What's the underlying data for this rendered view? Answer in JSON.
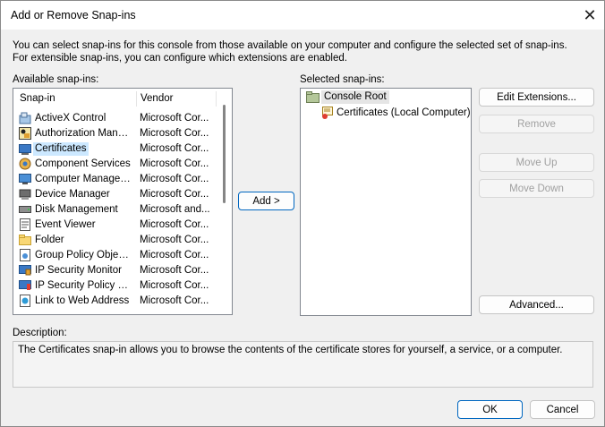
{
  "dialog": {
    "title": "Add or Remove Snap-ins",
    "intro": "You can select snap-ins for this console from those available on your computer and configure the selected set of snap-ins. For extensible snap-ins, you can configure which extensions are enabled."
  },
  "available": {
    "label": "Available snap-ins:",
    "col_snapin": "Snap-in",
    "col_vendor": "Vendor",
    "items": [
      {
        "name": "ActiveX Control",
        "vendor": "Microsoft Cor...",
        "icon": "activex-icon"
      },
      {
        "name": "Authorization Manager",
        "vendor": "Microsoft Cor...",
        "icon": "authorization-icon"
      },
      {
        "name": "Certificates",
        "vendor": "Microsoft Cor...",
        "icon": "certificates-icon"
      },
      {
        "name": "Component Services",
        "vendor": "Microsoft Cor...",
        "icon": "component-services-icon"
      },
      {
        "name": "Computer Managem...",
        "vendor": "Microsoft Cor...",
        "icon": "computer-management-icon"
      },
      {
        "name": "Device Manager",
        "vendor": "Microsoft Cor...",
        "icon": "device-manager-icon"
      },
      {
        "name": "Disk Management",
        "vendor": "Microsoft and...",
        "icon": "disk-management-icon"
      },
      {
        "name": "Event Viewer",
        "vendor": "Microsoft Cor...",
        "icon": "event-viewer-icon"
      },
      {
        "name": "Folder",
        "vendor": "Microsoft Cor...",
        "icon": "folder-icon"
      },
      {
        "name": "Group Policy Object ...",
        "vendor": "Microsoft Cor...",
        "icon": "group-policy-icon"
      },
      {
        "name": "IP Security Monitor",
        "vendor": "Microsoft Cor...",
        "icon": "ip-security-monitor-icon"
      },
      {
        "name": "IP Security Policy M...",
        "vendor": "Microsoft Cor...",
        "icon": "ip-security-policy-icon"
      },
      {
        "name": "Link to Web Address",
        "vendor": "Microsoft Cor...",
        "icon": "web-link-icon"
      }
    ]
  },
  "selected": {
    "label": "Selected snap-ins:",
    "root": "Console Root",
    "child": "Certificates (Local Computer)"
  },
  "buttons": {
    "add": "Add >",
    "edit_extensions": "Edit Extensions...",
    "remove": "Remove",
    "move_up": "Move Up",
    "move_down": "Move Down",
    "advanced": "Advanced...",
    "ok": "OK",
    "cancel": "Cancel"
  },
  "description": {
    "label": "Description:",
    "text": "The Certificates snap-in allows you to browse the contents of the certificate stores for yourself, a service, or a computer."
  },
  "colors": {
    "selection": "#cce8ff",
    "accent": "#0067c0"
  }
}
